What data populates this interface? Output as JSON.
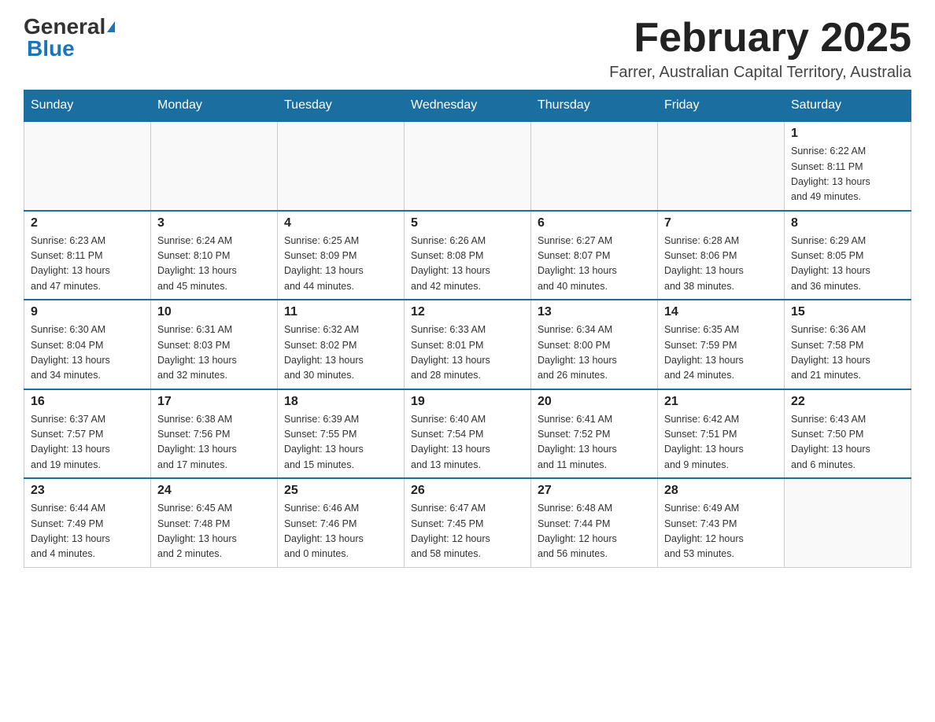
{
  "header": {
    "logo_general": "General",
    "logo_blue": "Blue",
    "month_title": "February 2025",
    "location": "Farrer, Australian Capital Territory, Australia"
  },
  "days_of_week": [
    "Sunday",
    "Monday",
    "Tuesday",
    "Wednesday",
    "Thursday",
    "Friday",
    "Saturday"
  ],
  "weeks": [
    [
      {
        "day": "",
        "info": ""
      },
      {
        "day": "",
        "info": ""
      },
      {
        "day": "",
        "info": ""
      },
      {
        "day": "",
        "info": ""
      },
      {
        "day": "",
        "info": ""
      },
      {
        "day": "",
        "info": ""
      },
      {
        "day": "1",
        "info": "Sunrise: 6:22 AM\nSunset: 8:11 PM\nDaylight: 13 hours\nand 49 minutes."
      }
    ],
    [
      {
        "day": "2",
        "info": "Sunrise: 6:23 AM\nSunset: 8:11 PM\nDaylight: 13 hours\nand 47 minutes."
      },
      {
        "day": "3",
        "info": "Sunrise: 6:24 AM\nSunset: 8:10 PM\nDaylight: 13 hours\nand 45 minutes."
      },
      {
        "day": "4",
        "info": "Sunrise: 6:25 AM\nSunset: 8:09 PM\nDaylight: 13 hours\nand 44 minutes."
      },
      {
        "day": "5",
        "info": "Sunrise: 6:26 AM\nSunset: 8:08 PM\nDaylight: 13 hours\nand 42 minutes."
      },
      {
        "day": "6",
        "info": "Sunrise: 6:27 AM\nSunset: 8:07 PM\nDaylight: 13 hours\nand 40 minutes."
      },
      {
        "day": "7",
        "info": "Sunrise: 6:28 AM\nSunset: 8:06 PM\nDaylight: 13 hours\nand 38 minutes."
      },
      {
        "day": "8",
        "info": "Sunrise: 6:29 AM\nSunset: 8:05 PM\nDaylight: 13 hours\nand 36 minutes."
      }
    ],
    [
      {
        "day": "9",
        "info": "Sunrise: 6:30 AM\nSunset: 8:04 PM\nDaylight: 13 hours\nand 34 minutes."
      },
      {
        "day": "10",
        "info": "Sunrise: 6:31 AM\nSunset: 8:03 PM\nDaylight: 13 hours\nand 32 minutes."
      },
      {
        "day": "11",
        "info": "Sunrise: 6:32 AM\nSunset: 8:02 PM\nDaylight: 13 hours\nand 30 minutes."
      },
      {
        "day": "12",
        "info": "Sunrise: 6:33 AM\nSunset: 8:01 PM\nDaylight: 13 hours\nand 28 minutes."
      },
      {
        "day": "13",
        "info": "Sunrise: 6:34 AM\nSunset: 8:00 PM\nDaylight: 13 hours\nand 26 minutes."
      },
      {
        "day": "14",
        "info": "Sunrise: 6:35 AM\nSunset: 7:59 PM\nDaylight: 13 hours\nand 24 minutes."
      },
      {
        "day": "15",
        "info": "Sunrise: 6:36 AM\nSunset: 7:58 PM\nDaylight: 13 hours\nand 21 minutes."
      }
    ],
    [
      {
        "day": "16",
        "info": "Sunrise: 6:37 AM\nSunset: 7:57 PM\nDaylight: 13 hours\nand 19 minutes."
      },
      {
        "day": "17",
        "info": "Sunrise: 6:38 AM\nSunset: 7:56 PM\nDaylight: 13 hours\nand 17 minutes."
      },
      {
        "day": "18",
        "info": "Sunrise: 6:39 AM\nSunset: 7:55 PM\nDaylight: 13 hours\nand 15 minutes."
      },
      {
        "day": "19",
        "info": "Sunrise: 6:40 AM\nSunset: 7:54 PM\nDaylight: 13 hours\nand 13 minutes."
      },
      {
        "day": "20",
        "info": "Sunrise: 6:41 AM\nSunset: 7:52 PM\nDaylight: 13 hours\nand 11 minutes."
      },
      {
        "day": "21",
        "info": "Sunrise: 6:42 AM\nSunset: 7:51 PM\nDaylight: 13 hours\nand 9 minutes."
      },
      {
        "day": "22",
        "info": "Sunrise: 6:43 AM\nSunset: 7:50 PM\nDaylight: 13 hours\nand 6 minutes."
      }
    ],
    [
      {
        "day": "23",
        "info": "Sunrise: 6:44 AM\nSunset: 7:49 PM\nDaylight: 13 hours\nand 4 minutes."
      },
      {
        "day": "24",
        "info": "Sunrise: 6:45 AM\nSunset: 7:48 PM\nDaylight: 13 hours\nand 2 minutes."
      },
      {
        "day": "25",
        "info": "Sunrise: 6:46 AM\nSunset: 7:46 PM\nDaylight: 13 hours\nand 0 minutes."
      },
      {
        "day": "26",
        "info": "Sunrise: 6:47 AM\nSunset: 7:45 PM\nDaylight: 12 hours\nand 58 minutes."
      },
      {
        "day": "27",
        "info": "Sunrise: 6:48 AM\nSunset: 7:44 PM\nDaylight: 12 hours\nand 56 minutes."
      },
      {
        "day": "28",
        "info": "Sunrise: 6:49 AM\nSunset: 7:43 PM\nDaylight: 12 hours\nand 53 minutes."
      },
      {
        "day": "",
        "info": ""
      }
    ]
  ]
}
